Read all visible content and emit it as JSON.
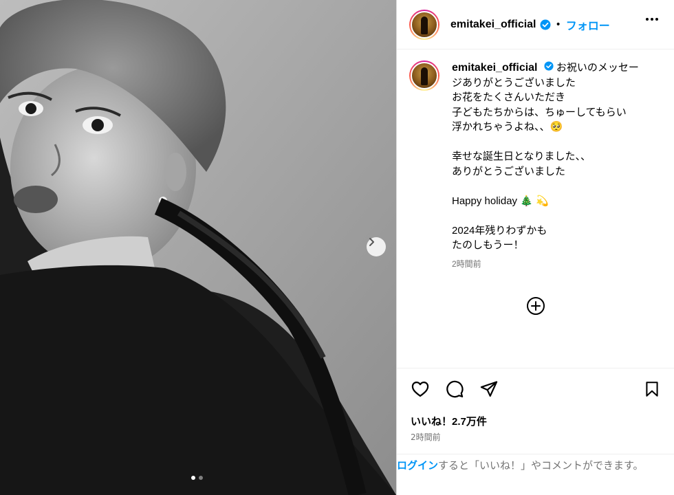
{
  "post": {
    "username": "emitakei_official",
    "separator": "•",
    "follow_label": "フォロー",
    "caption_lines": [
      "お祝いのメッセー",
      "ジありがとうございました",
      "お花をたくさんいただき",
      "子どもたちからは、ちゅーしてもらい",
      "浮かれちゃうよね、、🥺",
      "",
      "幸せな誕生日となりました、、",
      "ありがとうございました",
      "",
      "Happy holiday 🎄 💫",
      "",
      "2024年残りわずかも",
      "たのしもうー！"
    ],
    "caption_time": "2時間前",
    "likes": "いいね！2.7万件",
    "post_time": "2時間前"
  },
  "login": {
    "link": "ログイン",
    "text": "すると「いいね！」やコメントができます。"
  },
  "icons": {
    "verified": "verified-badge-icon",
    "more": "more-options-icon",
    "add_comment": "add-circle-icon",
    "like": "heart-icon",
    "comment": "comment-icon",
    "share": "send-icon",
    "save": "bookmark-icon",
    "next": "chevron-right-icon"
  },
  "carousel": {
    "slide_count": 2,
    "active_index": 0
  },
  "colors": {
    "accent": "#0095f6",
    "muted": "#737373",
    "verified": "#0095f6"
  }
}
